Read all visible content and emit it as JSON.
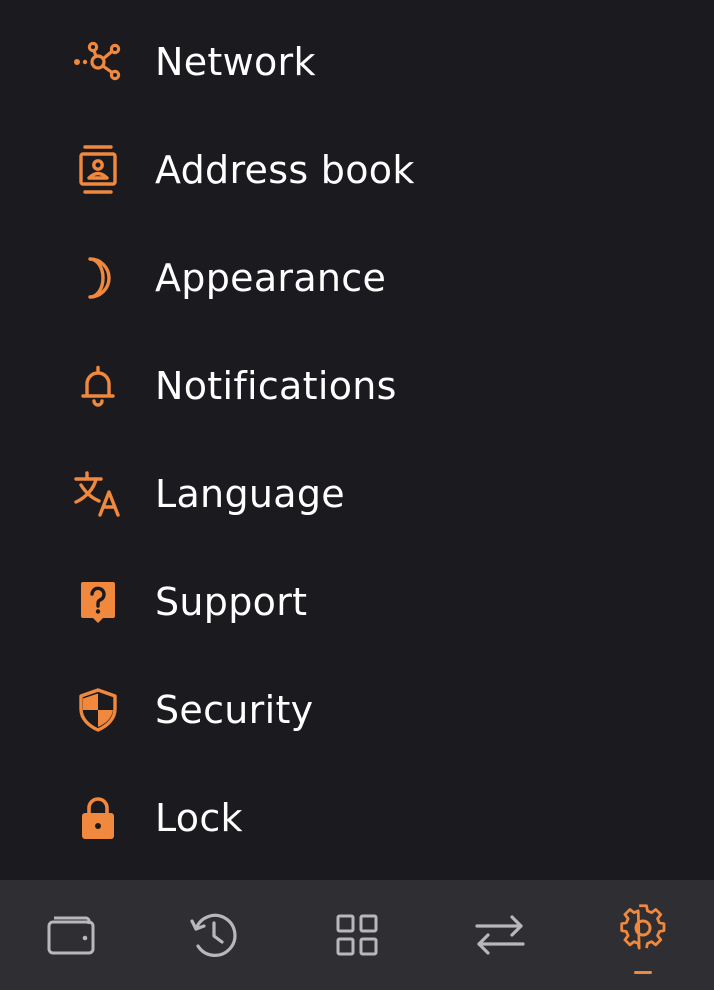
{
  "theme": {
    "background": "#1b1b1f",
    "bottom_bar": "#2f2f33",
    "accent": "#f0883e",
    "text": "#ffffff",
    "inactive_icon": "#b8b8bc"
  },
  "menu": {
    "items": [
      {
        "label": "Network",
        "icon": "network-icon"
      },
      {
        "label": "Address book",
        "icon": "address-book-icon"
      },
      {
        "label": "Appearance",
        "icon": "moon-icon"
      },
      {
        "label": "Notifications",
        "icon": "bell-icon"
      },
      {
        "label": "Language",
        "icon": "translate-icon"
      },
      {
        "label": "Support",
        "icon": "help-icon"
      },
      {
        "label": "Security",
        "icon": "shield-icon"
      },
      {
        "label": "Lock",
        "icon": "lock-icon"
      }
    ]
  },
  "bottom_nav": {
    "tabs": [
      {
        "icon": "wallet-icon",
        "active": false
      },
      {
        "icon": "history-icon",
        "active": false
      },
      {
        "icon": "apps-grid-icon",
        "active": false
      },
      {
        "icon": "swap-arrows-icon",
        "active": false
      },
      {
        "icon": "settings-gear-icon",
        "active": true
      }
    ]
  }
}
